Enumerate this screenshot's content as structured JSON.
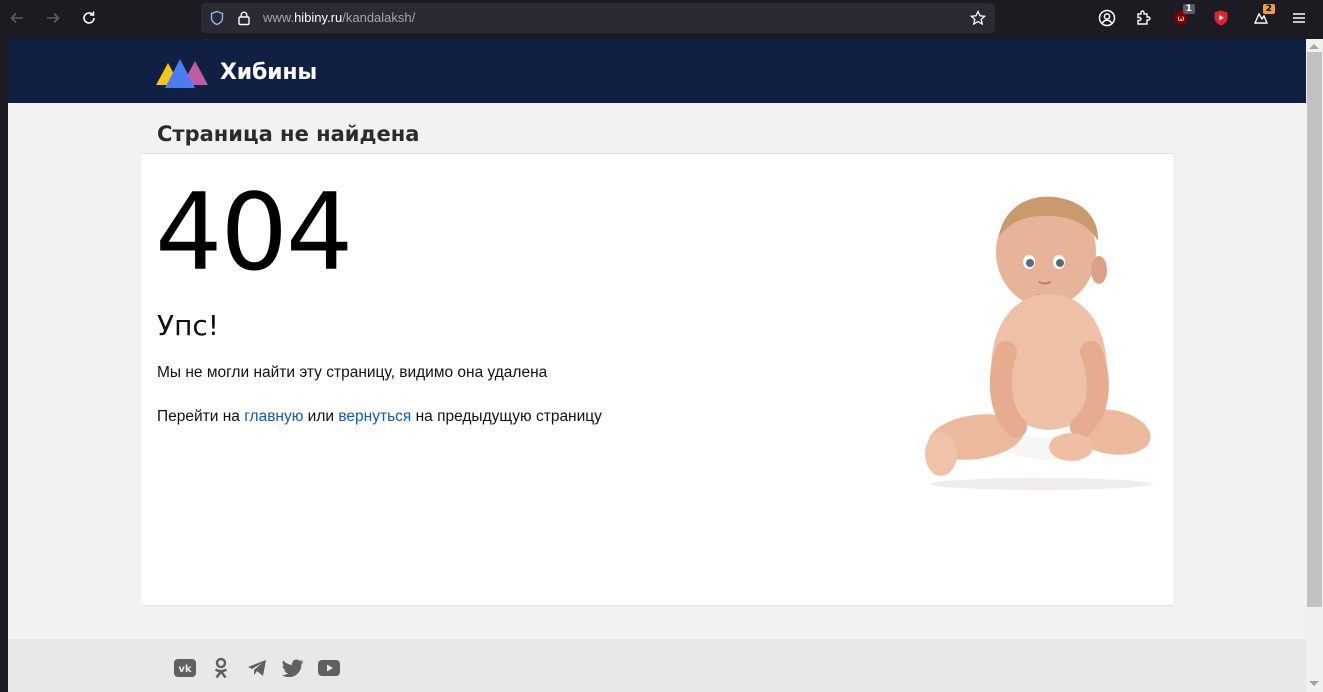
{
  "browser": {
    "url_prefix": "www.",
    "url_host": "hibiny.ru",
    "url_path": "/kandalaksh/",
    "extension_badges": [
      "1",
      "2"
    ]
  },
  "site": {
    "logo_text": "Хибины",
    "page_title": "Страница не найдена"
  },
  "error": {
    "code": "404",
    "heading": "Упс!",
    "message": "Мы не могли найти эту страницу, видимо она удалена",
    "nav_prefix": "Перейти на ",
    "home_link": "главную",
    "nav_middle": " или ",
    "back_link": "вернуться",
    "nav_suffix": " на предыдущую страницу"
  },
  "footer": {
    "social_icons": [
      "vk-icon",
      "odnoklassniki-icon",
      "telegram-icon",
      "twitter-icon",
      "youtube-icon"
    ]
  },
  "colors": {
    "header_bg": "#102042",
    "link": "#0a58ca",
    "page_bg": "#f2f2f2"
  }
}
